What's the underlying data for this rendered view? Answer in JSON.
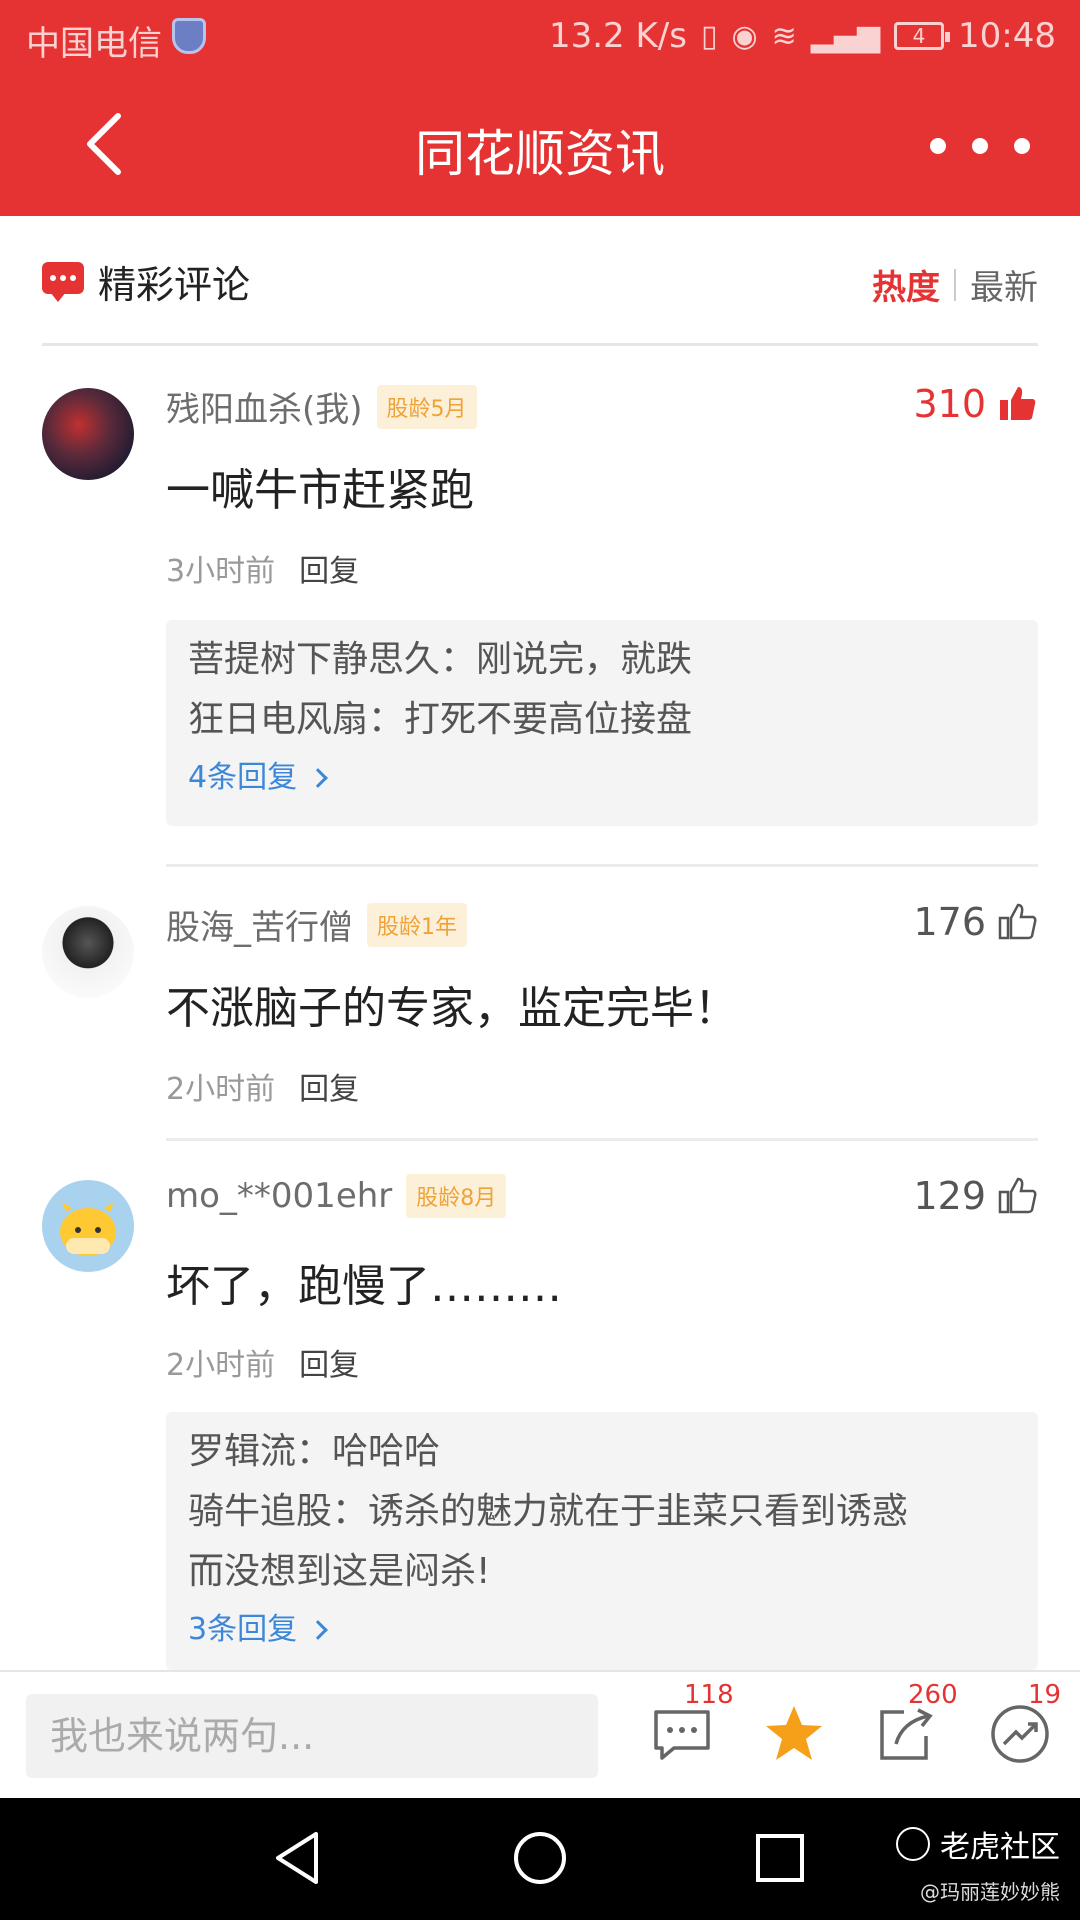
{
  "status_bar": {
    "carrier": "中国电信",
    "speed": "13.2 K/s",
    "battery": "4",
    "time": "10:48"
  },
  "header": {
    "title": "同花顺资讯"
  },
  "section": {
    "title": "精彩评论",
    "sort_hot": "热度",
    "sort_new": "最新"
  },
  "comments": [
    {
      "user": "残阳血杀(我)",
      "badge": "股龄5月",
      "likes": "310",
      "text": "一喊牛市赶紧跑",
      "time": "3小时前",
      "reply_label": "回复",
      "replies": [
        "菩提树下静思久：刚说完，就跌",
        "狂日电风扇：打死不要高位接盘"
      ],
      "more_replies": "4条回复"
    },
    {
      "user": "股海_苦行僧",
      "badge": "股龄1年",
      "likes": "176",
      "text": "不涨脑子的专家，监定完毕！",
      "time": "2小时前",
      "reply_label": "回复"
    },
    {
      "user": "mo_**001ehr",
      "badge": "股龄8月",
      "likes": "129",
      "text": "坏了，跑慢了………",
      "time": "2小时前",
      "reply_label": "回复",
      "replies": [
        "罗辑流：哈哈哈",
        "骑牛追股：诱杀的魅力就在于韭菜只看到诱惑",
        "而没想到这是闷杀!"
      ],
      "more_replies": "3条回复"
    }
  ],
  "bottom_bar": {
    "input_placeholder": "我也来说两句...",
    "comment_count": "118",
    "share_count": "260",
    "trend_count": "19"
  },
  "watermark": {
    "brand": "老虎社区",
    "user": "@玛丽莲妙妙熊"
  },
  "colors": {
    "brand_red": "#e53333",
    "link_blue": "#3c87d8",
    "badge_orange": "#f0a237"
  }
}
